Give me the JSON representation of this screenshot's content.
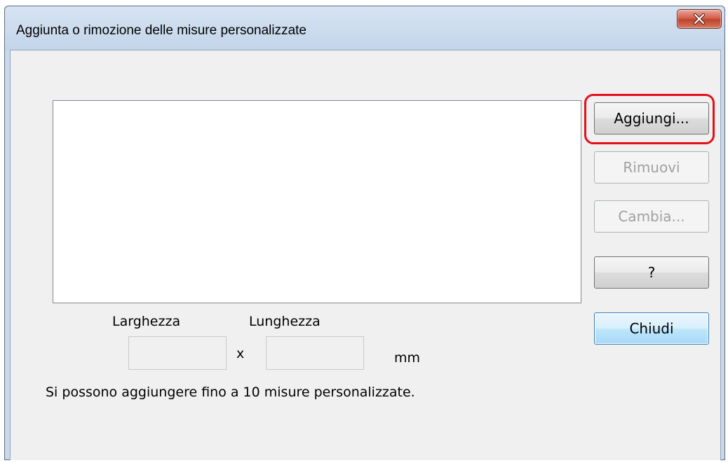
{
  "window": {
    "title": "Aggiunta o rimozione delle misure personalizzate",
    "close_glyph": "X"
  },
  "buttons": {
    "add": "Aggiungi...",
    "remove": "Rimuovi",
    "change": "Cambia...",
    "help": "?",
    "close": "Chiudi"
  },
  "size_fields": {
    "width_label": "Larghezza",
    "length_label": "Lunghezza",
    "separator": "x",
    "unit": "mm",
    "width_value": "",
    "length_value": ""
  },
  "note": "Si possono aggiungere fino a 10 misure personalizzate.",
  "custom_sizes": [],
  "colors": {
    "highlight": "#e3101a",
    "close_button": "#c1412a",
    "default_button_border": "#3c7fb1"
  }
}
